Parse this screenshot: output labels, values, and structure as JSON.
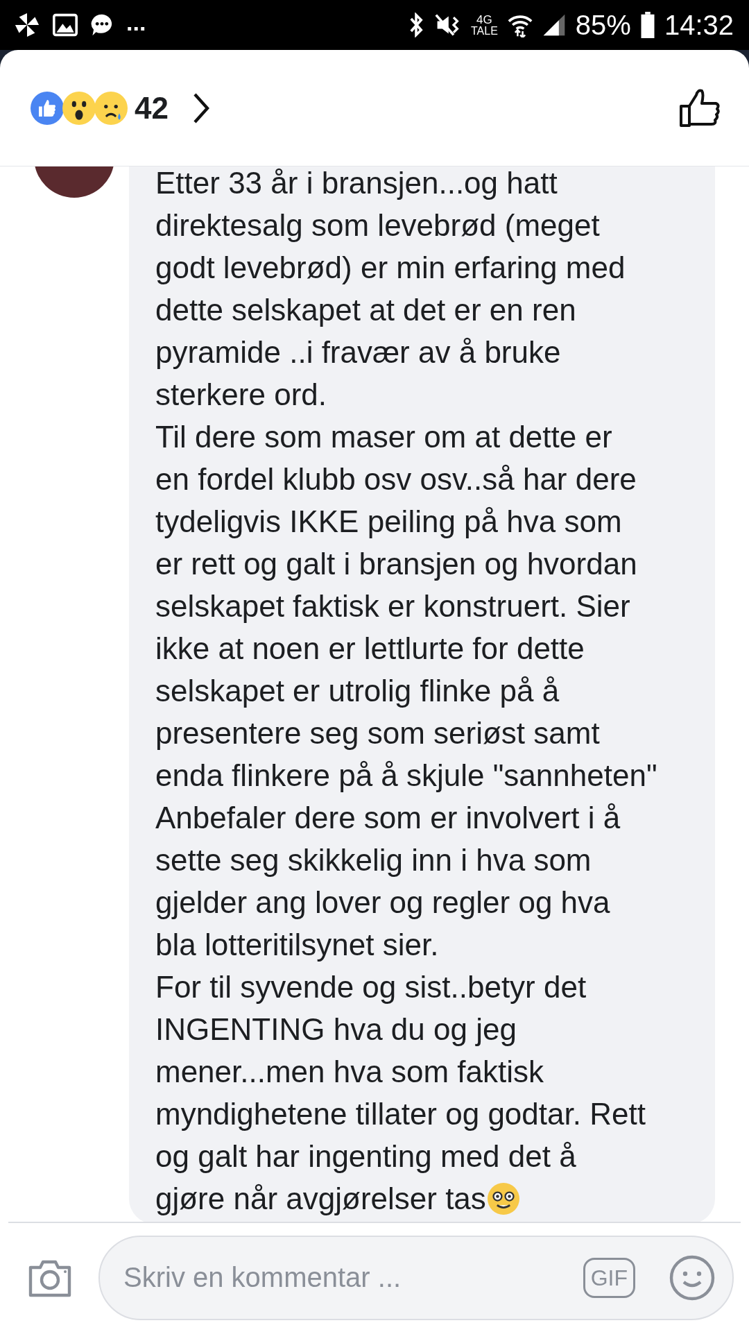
{
  "status_bar": {
    "more": "...",
    "network": "4G",
    "network_sub": "TALE",
    "battery": "85%",
    "time": "14:32"
  },
  "reactions": {
    "count": "42"
  },
  "comment": {
    "lines": [
      "Etter 33 år i bransjen...og hatt",
      "direktesalg som levebrød (meget",
      "godt levebrød) er min erfaring med",
      "dette selskapet at det er en ren",
      "pyramide ..i fravær av å bruke",
      "sterkere ord.",
      "Til dere som maser om at dette er",
      "en fordel klubb osv osv..så har dere",
      "tydeligvis IKKE peiling på hva som",
      "er rett og galt i bransjen og hvordan",
      "selskapet faktisk er konstruert. Sier",
      "ikke at noen er lettlurte for dette",
      "selskapet er utrolig flinke på å",
      "presentere seg som seriøst samt",
      "enda flinkere på å skjule \"sannheten\"",
      "Anbefaler dere som er involvert i å",
      "sette seg skikkelig inn i hva som",
      "gjelder ang lover og regler og hva",
      "bla lotteritilsynet sier.",
      "For til syvende og sist..betyr det",
      "INGENTING hva du og jeg",
      "mener...men hva som faktisk",
      "myndighetene tillater og godtar. Rett",
      "og galt har ingenting med det å",
      "gjøre når avgjørelser tas"
    ]
  },
  "composer": {
    "placeholder": "Skriv en kommentar ...",
    "gif": "GIF"
  }
}
